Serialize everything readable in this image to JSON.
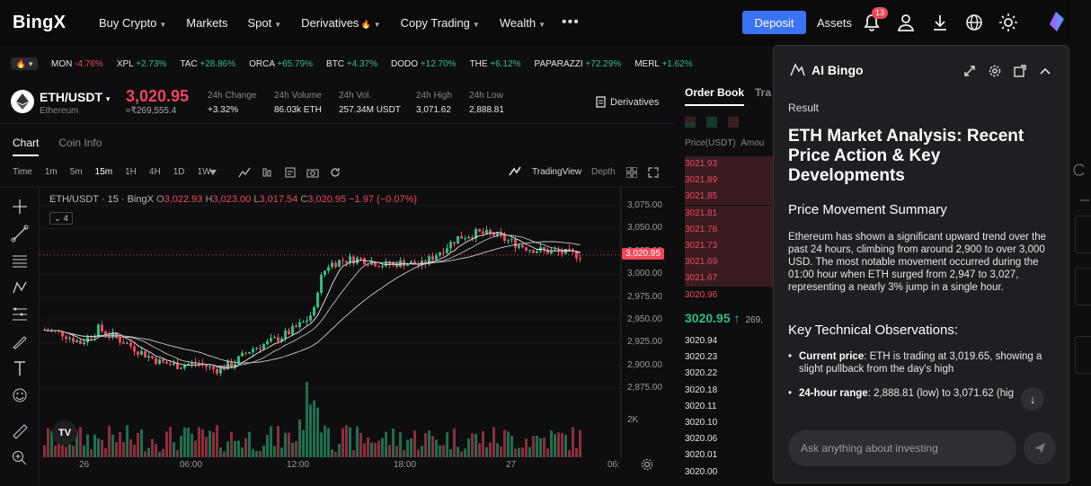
{
  "header": {
    "logo": "BingX",
    "nav": [
      {
        "label": "Buy Crypto",
        "chev": true
      },
      {
        "label": "Markets",
        "chev": false
      },
      {
        "label": "Spot",
        "chev": true
      },
      {
        "label": "Derivatives",
        "chev": true,
        "fire": true
      },
      {
        "label": "Copy Trading",
        "chev": true
      },
      {
        "label": "Wealth",
        "chev": true
      }
    ],
    "more": "•••",
    "deposit": "Deposit",
    "assets": "Assets",
    "notif_count": "13"
  },
  "ticker": [
    {
      "sym": "MON",
      "chg": "-4.76%",
      "dir": "down"
    },
    {
      "sym": "XPL",
      "chg": "+2.73%",
      "dir": "up"
    },
    {
      "sym": "TAC",
      "chg": "+28.86%",
      "dir": "up"
    },
    {
      "sym": "ORCA",
      "chg": "+65.79%",
      "dir": "up"
    },
    {
      "sym": "BTC",
      "chg": "+4.37%",
      "dir": "up"
    },
    {
      "sym": "DODO",
      "chg": "+12.70%",
      "dir": "up"
    },
    {
      "sym": "THE",
      "chg": "+6.12%",
      "dir": "up"
    },
    {
      "sym": "PAPARAZZI",
      "chg": "+72.29%",
      "dir": "up"
    },
    {
      "sym": "MERL",
      "chg": "+1.62%",
      "dir": "up"
    }
  ],
  "market": {
    "pair": "ETH/USDT",
    "name": "Ethereum",
    "price": "3,020.95",
    "price_fiat": "≈₹269,555.4",
    "stats": [
      {
        "label": "24h Change",
        "value": "+3.32%",
        "dir": "up"
      },
      {
        "label": "24h Volume",
        "value": "86.03k ETH",
        "dir": ""
      },
      {
        "label": "24h Vol.",
        "value": "257.34M USDT",
        "dir": ""
      },
      {
        "label": "24h High",
        "value": "3,071.62",
        "dir": ""
      },
      {
        "label": "24h Low",
        "value": "2,888.81",
        "dir": ""
      }
    ],
    "derivatives": "Derivatives"
  },
  "chart_tabs": [
    "Chart",
    "Coin Info"
  ],
  "timeframes": [
    "Time",
    "1m",
    "5m",
    "15m",
    "1H",
    "4H",
    "1D",
    "1W"
  ],
  "selected_tf": "15m",
  "tradingview_label": "TradingView",
  "depth_label": "Depth",
  "legend": {
    "title": "ETH/USDT · 15 · BingX",
    "o": "3,022.93",
    "h": "3,023.00",
    "l": "3,017.54",
    "c": "3,020.95",
    "chg": "−1.97 (−0.07%)",
    "indicators": "4"
  },
  "chart_data": {
    "type": "candlestick",
    "title": "ETH/USDT · 15 · BingX",
    "y_ticks": [
      "3,075.00",
      "3,050.00",
      "3,025.00",
      "3,000.00",
      "2,975.00",
      "2,950.00",
      "2,925.00",
      "2,900.00",
      "2,875.00"
    ],
    "x_ticks": [
      "26",
      "06:00",
      "12:00",
      "18:00",
      "27",
      "06:"
    ],
    "last_price": "3,020.95",
    "volume_tick": "2K",
    "ylim": [
      2875,
      3075
    ]
  },
  "orderbook": {
    "tabs": [
      "Order Book",
      "Tra"
    ],
    "header": "Price(USDT)",
    "header2": "Amou",
    "asks": [
      "3021.93",
      "3021.89",
      "3021.85",
      "3021.81",
      "3021.78",
      "3021.73",
      "3021.69",
      "3021.67",
      "3020.96"
    ],
    "last": "3020.95 ↑",
    "last_sub": "269,",
    "bids": [
      "3020.94",
      "3020.23",
      "3020.22",
      "3020.18",
      "3020.11",
      "3020.10",
      "3020.06",
      "3020.01",
      "3020.00"
    ]
  },
  "ai": {
    "title": "AI Bingo",
    "result": "Result",
    "headline": "ETH Market Analysis: Recent Price Action & Key Developments",
    "s1": "Price Movement Summary",
    "p1": "Ethereum has shown a significant upward trend over the past 24 hours, climbing from around 2,900 to over 3,000 USD. The most notable movement occurred during the 01:00 hour when ETH surged from 2,947 to 3,027, representing a nearly 3% jump in a single hour.",
    "s2": "Key Technical Observations:",
    "b1k": "Current price",
    "b1": ": ETH is trading at 3,019.65, showing a slight pullback from the day's high",
    "b2k": "24-hour range",
    "b2": ": 2,888.81 (low) to 3,071.62 (hig",
    "placeholder": "Ask anything about investing"
  }
}
